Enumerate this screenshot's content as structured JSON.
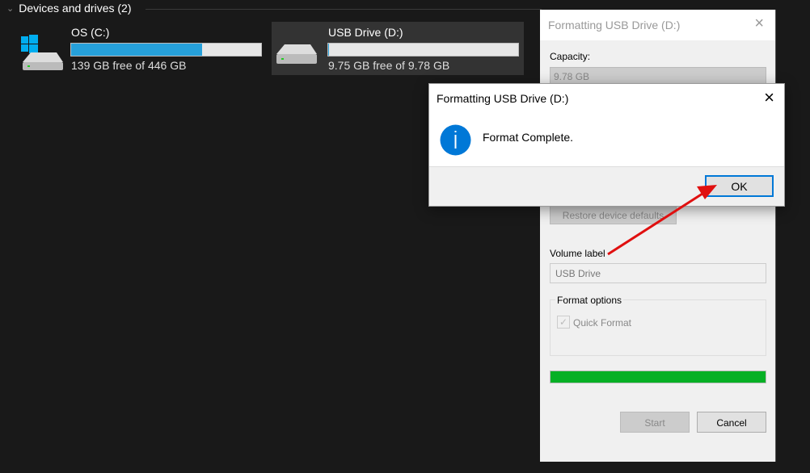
{
  "section": {
    "title": "Devices and drives (2)"
  },
  "drives": [
    {
      "name": "OS (C:)",
      "free": "139 GB free of 446 GB",
      "used_percent": 68.8,
      "icon": "windows-drive-icon"
    },
    {
      "name": "USB Drive (D:)",
      "free": "9.75 GB free of 9.78 GB",
      "used_percent": 0.3,
      "icon": "usb-drive-icon"
    }
  ],
  "format_dialog": {
    "title": "Formatting USB Drive (D:)",
    "capacity_label": "Capacity:",
    "capacity_value": "9.78 GB",
    "restore_label": "Restore device defaults",
    "volume_label": "Volume label",
    "volume_value": "USB Drive",
    "options_label": "Format options",
    "quick_format": "Quick Format",
    "quick_format_checked": true,
    "progress_percent": 100,
    "start": "Start",
    "cancel": "Cancel"
  },
  "message_box": {
    "title": "Formatting USB Drive (D:)",
    "message": "Format Complete.",
    "ok": "OK",
    "icon": "info-icon"
  },
  "colors": {
    "accent": "#26a0da",
    "progress": "#06b025",
    "arrow": "#e01010",
    "info": "#0078d7"
  }
}
